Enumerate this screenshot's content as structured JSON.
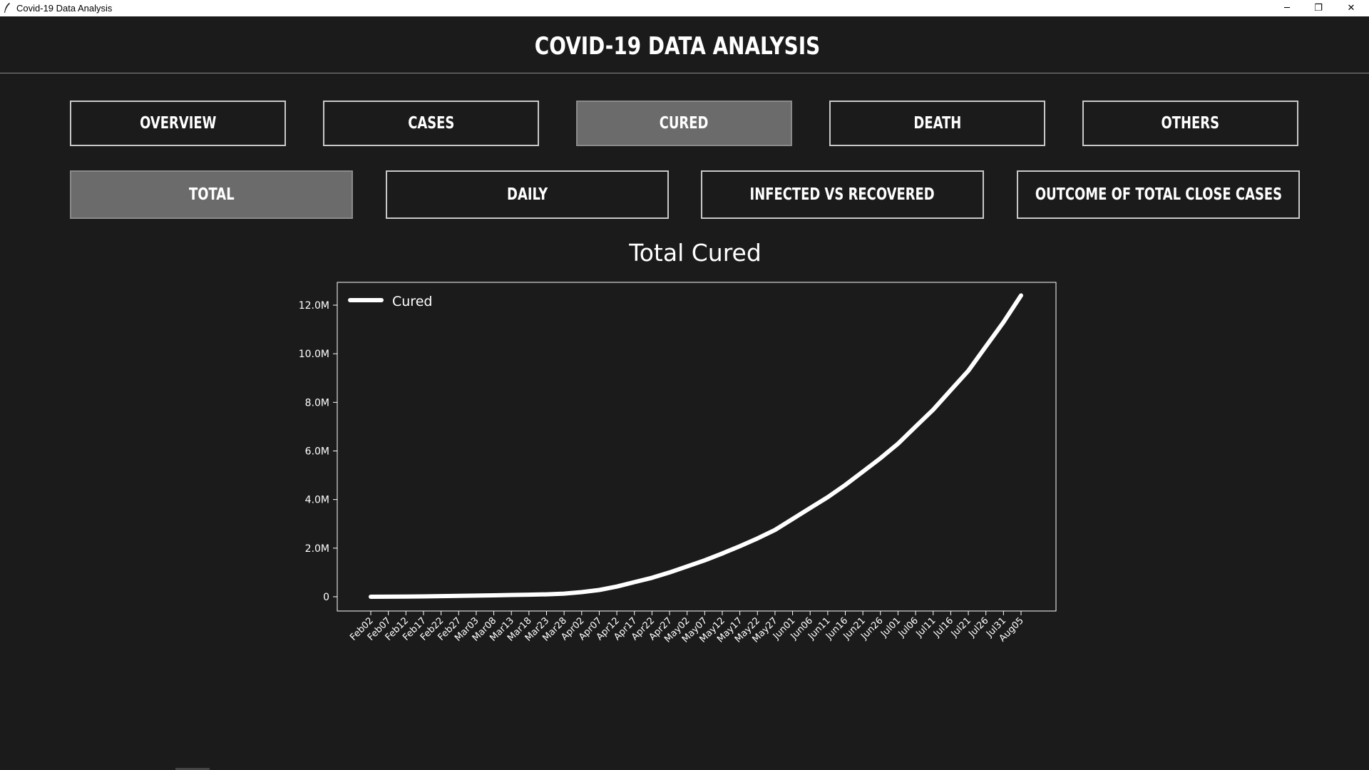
{
  "window": {
    "title": "Covid-19 Data Analysis",
    "controls": {
      "minimize": "─",
      "maximize": "❐",
      "close": "✕"
    }
  },
  "header": {
    "title": "COVID-19 DATA ANALYSIS"
  },
  "nav": {
    "tabs": [
      {
        "label": "OVERVIEW",
        "active": false
      },
      {
        "label": "CASES",
        "active": false
      },
      {
        "label": "CURED",
        "active": true
      },
      {
        "label": "DEATH",
        "active": false
      },
      {
        "label": "OTHERS",
        "active": false
      }
    ],
    "subtabs": [
      {
        "label": "TOTAL",
        "active": true
      },
      {
        "label": "DAILY",
        "active": false
      },
      {
        "label": "INFECTED VS RECOVERED",
        "active": false
      },
      {
        "label": "OUTCOME OF TOTAL CLOSE CASES",
        "active": false
      }
    ]
  },
  "colors": {
    "background": "#1b1b1b",
    "active_button": "#6b6b6b",
    "border": "#c8c8c8",
    "line": "#ffffff"
  },
  "chart_data": {
    "type": "line",
    "title": "Total Cured",
    "xlabel": "",
    "ylabel": "",
    "legend": "top-left",
    "grid": false,
    "ylim": [
      0,
      12600000
    ],
    "y_ticks": [
      0,
      2000000,
      4000000,
      6000000,
      8000000,
      10000000,
      12000000
    ],
    "y_tick_labels": [
      "0",
      "2.0M",
      "4.0M",
      "6.0M",
      "8.0M",
      "10.0M",
      "12.0M"
    ],
    "x_tick_labels": [
      "Feb02",
      "Feb07",
      "Feb12",
      "Feb17",
      "Feb22",
      "Feb27",
      "Mar03",
      "Mar08",
      "Mar13",
      "Mar18",
      "Mar23",
      "Mar28",
      "Apr02",
      "Apr07",
      "Apr12",
      "Apr17",
      "Apr22",
      "Apr27",
      "May02",
      "May07",
      "May12",
      "May17",
      "May22",
      "May27",
      "Jun01",
      "Jun06",
      "Jun11",
      "Jun16",
      "Jun21",
      "Jun26",
      "Jul01",
      "Jul06",
      "Jul11",
      "Jul16",
      "Jul21",
      "Jul26",
      "Jul31",
      "Aug05"
    ],
    "series": [
      {
        "name": "Cured",
        "x": [
          "Feb02",
          "Feb07",
          "Feb12",
          "Feb17",
          "Feb22",
          "Feb27",
          "Mar03",
          "Mar08",
          "Mar13",
          "Mar18",
          "Mar23",
          "Mar28",
          "Apr02",
          "Apr07",
          "Apr12",
          "Apr17",
          "Apr22",
          "Apr27",
          "May02",
          "May07",
          "May12",
          "May17",
          "May22",
          "May27",
          "Jun01",
          "Jun06",
          "Jun11",
          "Jun16",
          "Jun21",
          "Jun26",
          "Jul01",
          "Jul06",
          "Jul11",
          "Jul16",
          "Jul21",
          "Jul26",
          "Jul31",
          "Aug05"
        ],
        "values": [
          500,
          2000,
          7000,
          14000,
          25000,
          36000,
          48000,
          60000,
          73000,
          85000,
          100000,
          130000,
          190000,
          280000,
          420000,
          600000,
          780000,
          1000000,
          1250000,
          1500000,
          1780000,
          2080000,
          2400000,
          2750000,
          3200000,
          3650000,
          4100000,
          4600000,
          5150000,
          5700000,
          6300000,
          7000000,
          7700000,
          8500000,
          9300000,
          10300000,
          11300000,
          12400000
        ]
      }
    ]
  }
}
